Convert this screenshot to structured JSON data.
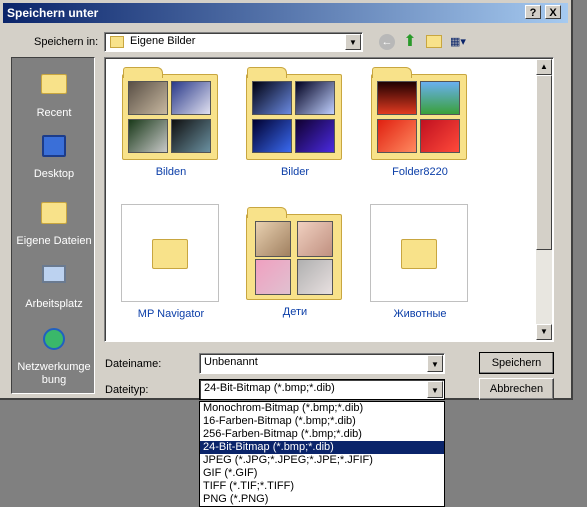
{
  "window": {
    "title": "Speichern unter",
    "help_btn": "?",
    "close_btn": "X"
  },
  "toolbar": {
    "save_in_label": "Speichern in:",
    "location": "Eigene Bilder"
  },
  "places": [
    {
      "label": "Recent",
      "icon": "recent-icon"
    },
    {
      "label": "Desktop",
      "icon": "desktop-icon"
    },
    {
      "label": "Eigene Dateien",
      "icon": "my-documents-icon"
    },
    {
      "label": "Arbeitsplatz",
      "icon": "my-computer-icon"
    },
    {
      "label": "Netzwerkumge bung",
      "icon": "network-icon"
    }
  ],
  "items": [
    {
      "label": "Bilden"
    },
    {
      "label": "Bilder"
    },
    {
      "label": "Folder8220"
    },
    {
      "label": "MP Navigator"
    },
    {
      "label": "Дети"
    },
    {
      "label": "Животные"
    }
  ],
  "form": {
    "filename_label": "Dateiname:",
    "filename_value": "Unbenannt",
    "filetype_label": "Dateityp:",
    "filetype_value": "24-Bit-Bitmap (*.bmp;*.dib)",
    "save_button": "Speichern",
    "cancel_button": "Abbrechen"
  },
  "filetype_options": [
    "Monochrom-Bitmap (*.bmp;*.dib)",
    "16-Farben-Bitmap (*.bmp;*.dib)",
    "256-Farben-Bitmap (*.bmp;*.dib)",
    "24-Bit-Bitmap (*.bmp;*.dib)",
    "JPEG (*.JPG;*.JPEG;*.JPE;*.JFIF)",
    "GIF (*.GIF)",
    "TIFF (*.TIF;*.TIFF)",
    "PNG (*.PNG)"
  ],
  "selected_option_index": 3,
  "colors": {
    "title_start": "#0a246a",
    "title_end": "#a6caf0",
    "link_text": "#0b3ea8",
    "face": "#d4d0c8",
    "folder": "#f8e28a"
  }
}
